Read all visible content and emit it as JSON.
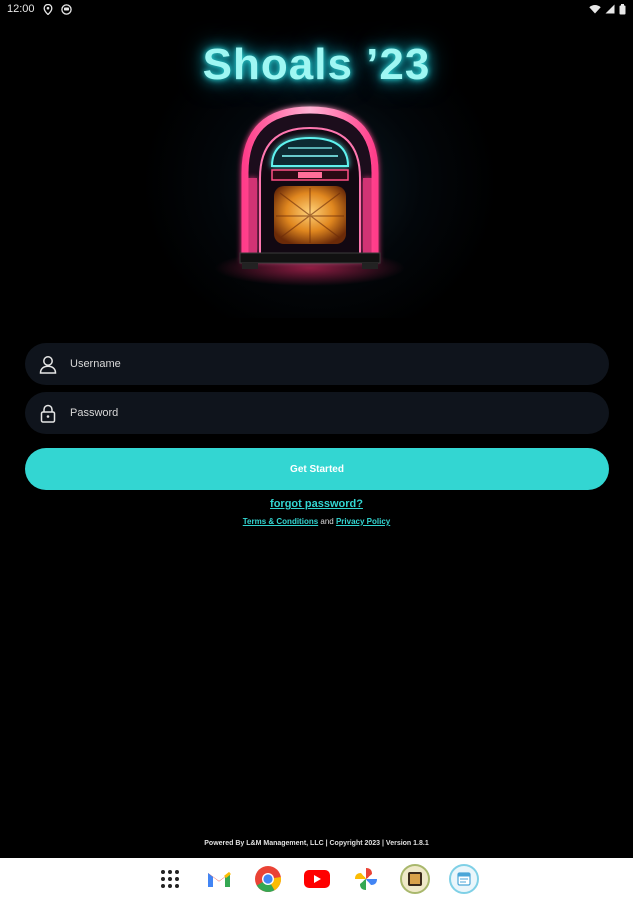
{
  "status_bar": {
    "time": "12:00",
    "icons": [
      "location-icon",
      "notification-icon",
      "wifi-icon",
      "signal-icon",
      "battery-icon"
    ]
  },
  "app": {
    "title": "Shoals ’23",
    "hero_image": "jukebox-illustration",
    "accent_color": "#33d6d2"
  },
  "login": {
    "username_placeholder": "Username",
    "username_value": "",
    "password_placeholder": "Password",
    "password_value": "",
    "submit_label": "Get Started",
    "forgot_password_label": "forgot password?",
    "terms_label": "Terms & Conditions",
    "and_text": " and ",
    "privacy_label": "Privacy Policy"
  },
  "footer": {
    "text": "Powered By L&M Management, LLC | Copyright 2023 | Version 1.8.1"
  },
  "dock": {
    "apps": [
      "app-drawer-icon",
      "gmail-icon",
      "chrome-icon",
      "youtube-icon",
      "photos-icon",
      "gallery-icon",
      "calendar-icon"
    ]
  }
}
